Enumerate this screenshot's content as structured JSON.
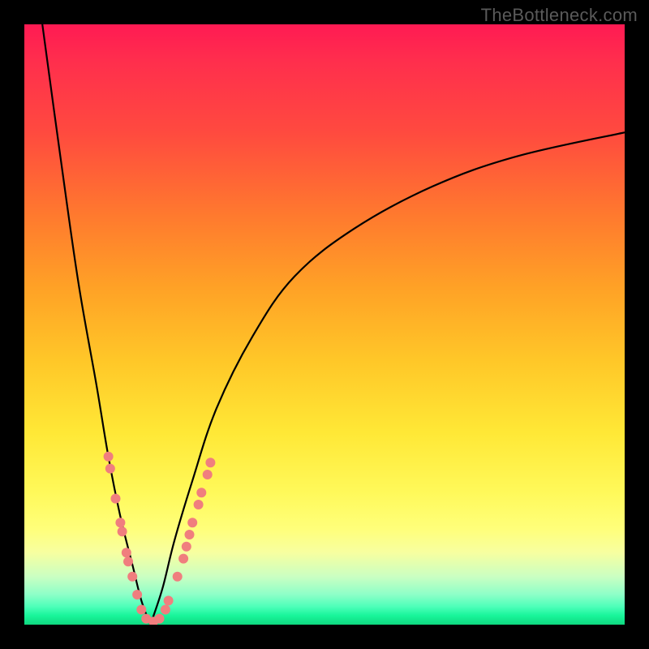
{
  "watermark": "TheBottleneck.com",
  "colors": {
    "frame": "#000000",
    "curve": "#000000",
    "marker": "#f07e7e"
  },
  "chart_data": {
    "type": "line",
    "title": "",
    "xlabel": "",
    "ylabel": "",
    "xlim": [
      0,
      100
    ],
    "ylim": [
      0,
      100
    ],
    "grid": false,
    "legend": false,
    "description": "Minimum-bottleneck curve. Two branches descend from top edges and meet near x≈20 at y≈0. Background gradient maps y: 0→green (good match) to 100→red (severe bottleneck).",
    "series": [
      {
        "name": "left-branch",
        "x": [
          3,
          6,
          9,
          12,
          14,
          16,
          18,
          19.5,
          21
        ],
        "values": [
          100,
          78,
          57,
          40,
          28,
          18,
          10,
          4,
          0
        ]
      },
      {
        "name": "right-branch",
        "x": [
          21,
          23,
          25,
          28,
          32,
          38,
          45,
          55,
          68,
          82,
          100
        ],
        "values": [
          0,
          6,
          14,
          24,
          36,
          48,
          58,
          66,
          73,
          78,
          82
        ]
      }
    ],
    "markers": [
      {
        "x": 14.0,
        "y": 28.0
      },
      {
        "x": 14.3,
        "y": 26.0
      },
      {
        "x": 15.2,
        "y": 21.0
      },
      {
        "x": 16.0,
        "y": 17.0
      },
      {
        "x": 16.3,
        "y": 15.5
      },
      {
        "x": 17.0,
        "y": 12.0
      },
      {
        "x": 17.3,
        "y": 10.5
      },
      {
        "x": 18.0,
        "y": 8.0
      },
      {
        "x": 18.8,
        "y": 5.0
      },
      {
        "x": 19.5,
        "y": 2.5
      },
      {
        "x": 20.3,
        "y": 1.0
      },
      {
        "x": 21.5,
        "y": 0.5
      },
      {
        "x": 22.5,
        "y": 1.0
      },
      {
        "x": 23.5,
        "y": 2.5
      },
      {
        "x": 24.0,
        "y": 4.0
      },
      {
        "x": 25.5,
        "y": 8.0
      },
      {
        "x": 26.5,
        "y": 11.0
      },
      {
        "x": 27.0,
        "y": 13.0
      },
      {
        "x": 27.5,
        "y": 15.0
      },
      {
        "x": 28.0,
        "y": 17.0
      },
      {
        "x": 29.0,
        "y": 20.0
      },
      {
        "x": 29.5,
        "y": 22.0
      },
      {
        "x": 30.5,
        "y": 25.0
      },
      {
        "x": 31.0,
        "y": 27.0
      }
    ],
    "marker_radius": 6
  }
}
